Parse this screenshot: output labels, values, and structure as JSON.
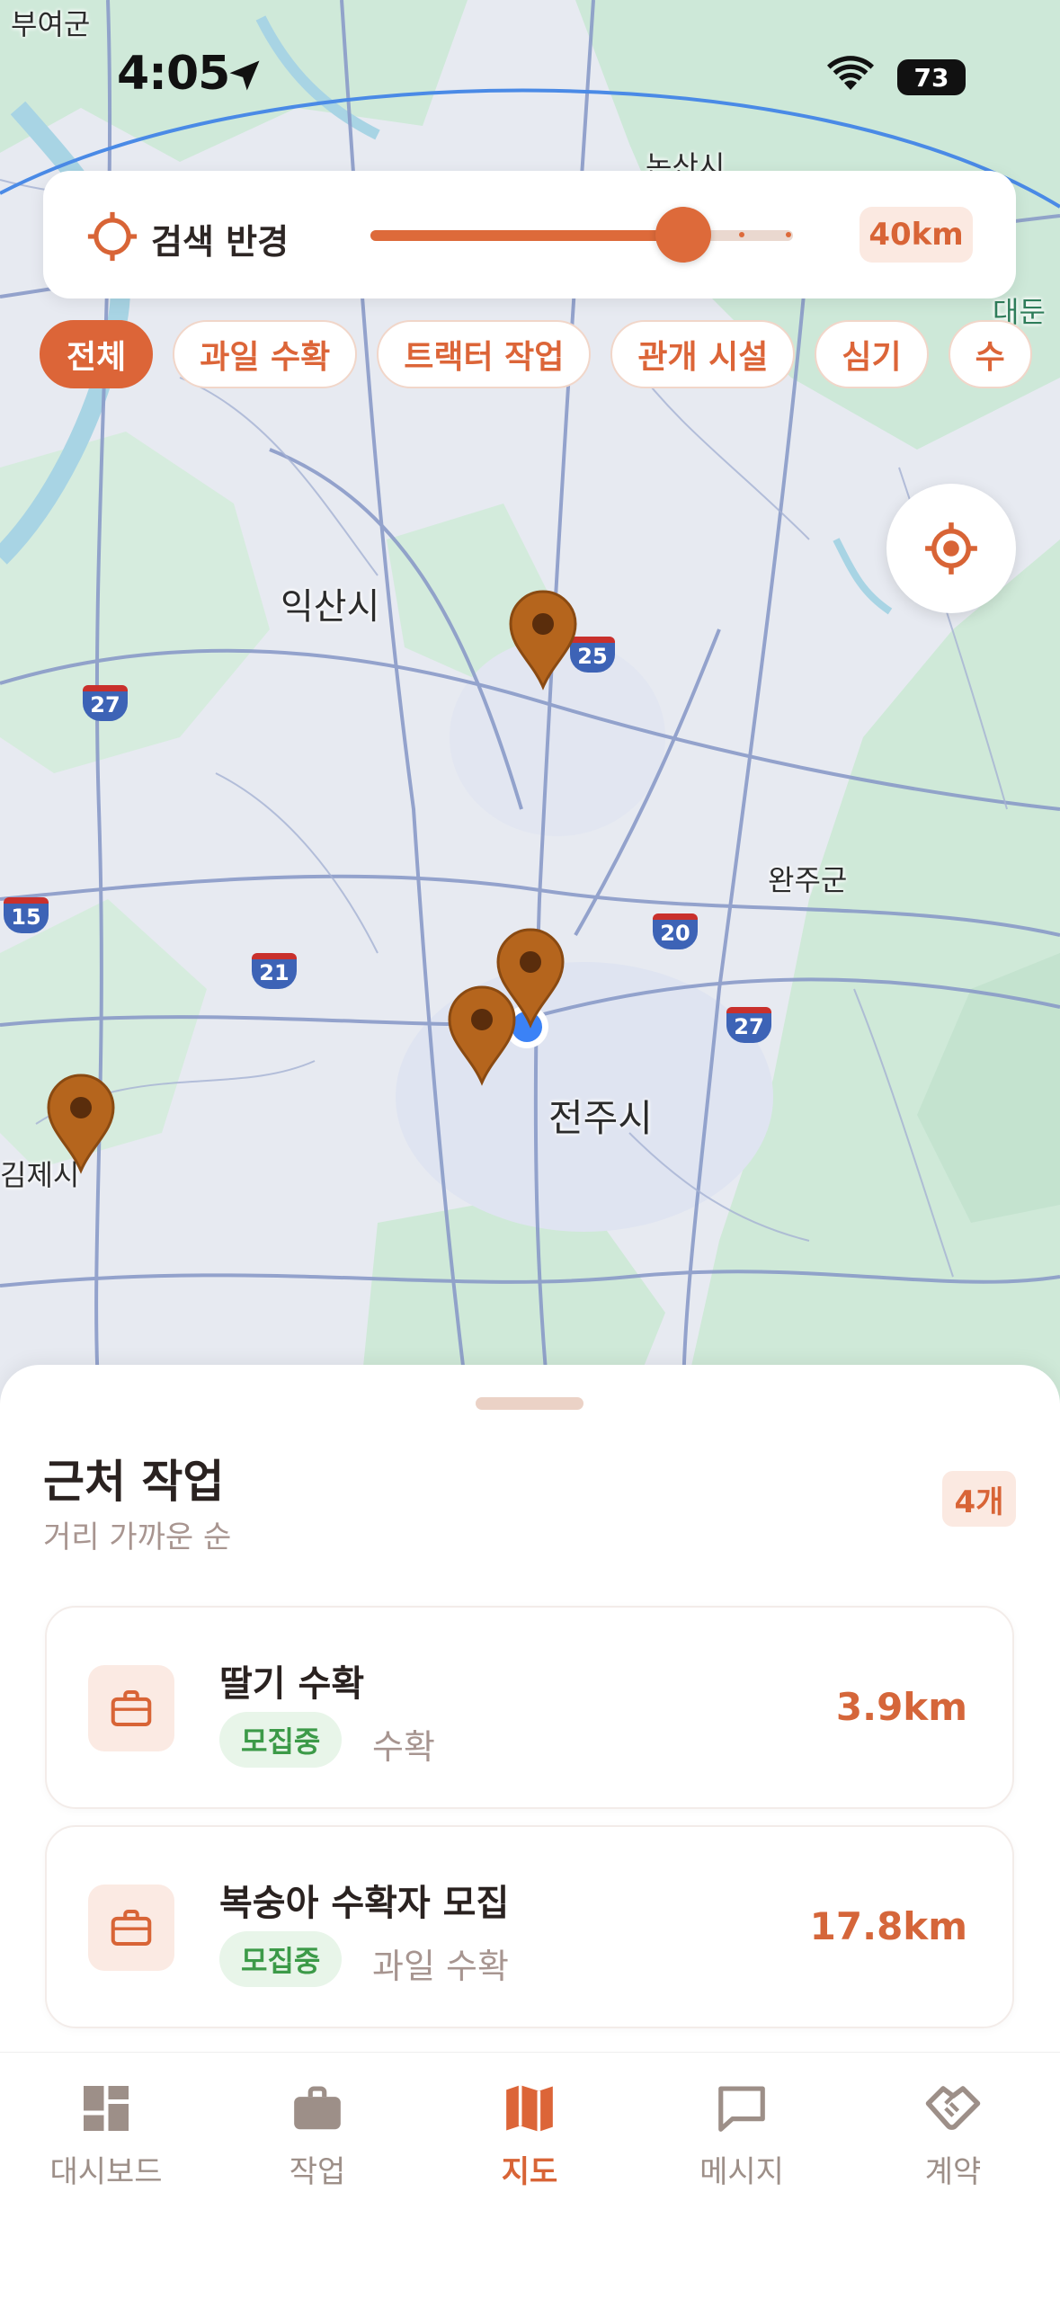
{
  "status_bar": {
    "time": "4:05",
    "battery": "73"
  },
  "map": {
    "places": {
      "buyeo": "부여군",
      "nonsan": "논산시",
      "daedun": "대둔",
      "iksan": "익산시",
      "wanju": "완주군",
      "jeonju": "전주시",
      "gimje": "김제시"
    },
    "road_shields": [
      "25",
      "27",
      "15",
      "21",
      "20",
      "27"
    ]
  },
  "radius": {
    "title": "검색 반경",
    "value": "40km",
    "level_fraction": 0.74
  },
  "filters": {
    "chips": [
      {
        "label": "전체",
        "active": true
      },
      {
        "label": "과일 수확",
        "active": false
      },
      {
        "label": "트랙터 작업",
        "active": false
      },
      {
        "label": "관개 시설",
        "active": false
      },
      {
        "label": "심기",
        "active": false
      },
      {
        "label": "수",
        "active": false
      }
    ]
  },
  "sheet": {
    "title": "근처 작업",
    "subtitle": "거리 가까운 순",
    "count": "4개",
    "jobs": [
      {
        "title": "딸기 수확",
        "status": "모집중",
        "category": "수확",
        "distance": "3.9km"
      },
      {
        "title": "복숭아 수확자 모집",
        "status": "모집중",
        "category": "과일 수확",
        "distance": "17.8km"
      }
    ]
  },
  "tabs": [
    {
      "label": "대시보드",
      "icon": "dashboard-icon",
      "active": false
    },
    {
      "label": "작업",
      "icon": "briefcase-icon",
      "active": false
    },
    {
      "label": "지도",
      "icon": "map-icon",
      "active": true
    },
    {
      "label": "메시지",
      "icon": "message-icon",
      "active": false
    },
    {
      "label": "계약",
      "icon": "handshake-icon",
      "active": false
    }
  ],
  "colors": {
    "accent": "#dc6538",
    "pin": "#b5651d",
    "status_green": "#3c9a48",
    "user_location": "#3b82f6"
  }
}
